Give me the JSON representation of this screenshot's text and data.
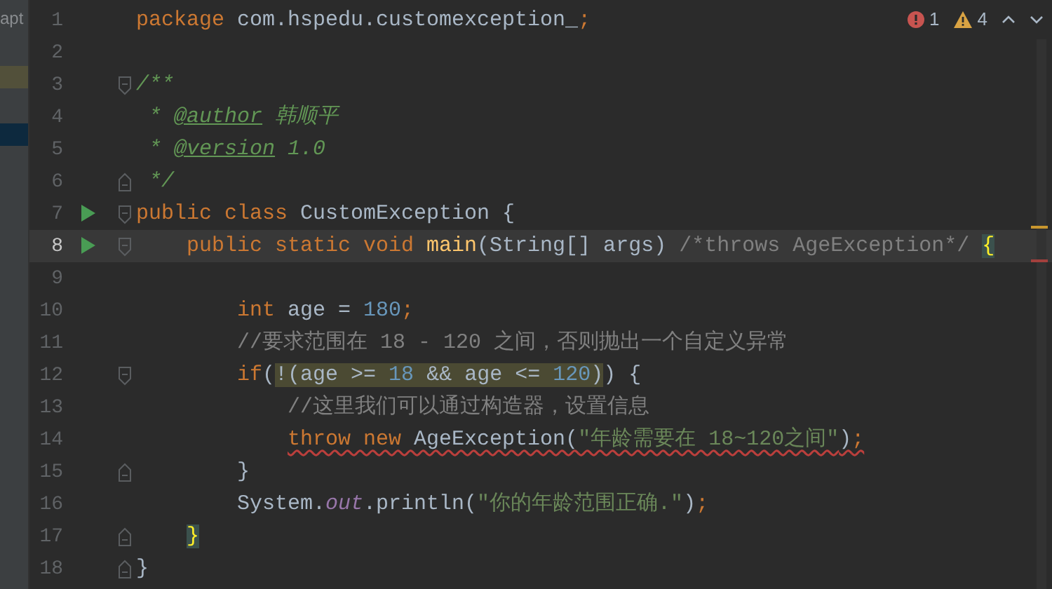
{
  "project_panel": {
    "label": "apt",
    "rows": [
      {
        "kind": "search-hit"
      },
      {
        "kind": "selected"
      }
    ]
  },
  "inspections": {
    "errors": "1",
    "warnings": "4"
  },
  "lines": [
    {
      "number": "1",
      "current": false,
      "run": false,
      "fold_open": false,
      "fold_close": false,
      "tokens": [
        {
          "kind": "keyword",
          "text": "package"
        },
        {
          "kind": "plain",
          "text": " com.hspedu.customexception_"
        },
        {
          "kind": "punct",
          "text": ";"
        }
      ]
    },
    {
      "number": "2",
      "current": false,
      "run": false,
      "fold_open": false,
      "fold_close": false
    },
    {
      "number": "3",
      "current": false,
      "run": false,
      "fold_open": true,
      "fold_close": false,
      "tokens": [
        {
          "kind": "doc",
          "text": "/**"
        }
      ]
    },
    {
      "number": "4",
      "current": false,
      "run": false,
      "fold_open": false,
      "fold_close": false,
      "tokens": [
        {
          "kind": "doc",
          "text": " * "
        },
        {
          "kind": "doctag",
          "text": "@author"
        },
        {
          "kind": "doc",
          "text": " 韩顺平"
        }
      ]
    },
    {
      "number": "5",
      "current": false,
      "run": false,
      "fold_open": false,
      "fold_close": false,
      "tokens": [
        {
          "kind": "doc",
          "text": " * "
        },
        {
          "kind": "doctag",
          "text": "@version"
        },
        {
          "kind": "doc",
          "text": " 1.0"
        }
      ]
    },
    {
      "number": "6",
      "current": false,
      "run": false,
      "fold_open": false,
      "fold_close": true,
      "tokens": [
        {
          "kind": "doc",
          "text": " */"
        }
      ]
    },
    {
      "number": "7",
      "current": false,
      "run": true,
      "fold_open": true,
      "fold_close": false,
      "tokens": [
        {
          "kind": "keyword",
          "text": "public class "
        },
        {
          "kind": "plain",
          "text": "CustomException {"
        }
      ]
    },
    {
      "number": "8",
      "current": true,
      "run": true,
      "fold_open": true,
      "fold_close": false,
      "tokens": [
        {
          "kind": "keyword",
          "text": "    public static void "
        },
        {
          "kind": "method",
          "text": "main"
        },
        {
          "kind": "plain",
          "text": "(String[] args) "
        },
        {
          "kind": "comment",
          "text": "/*throws AgeException*/"
        },
        {
          "kind": "brace",
          "text": " {"
        }
      ]
    },
    {
      "number": "9",
      "current": false,
      "run": false,
      "fold_open": false,
      "fold_close": false
    },
    {
      "number": "10",
      "current": false,
      "run": false,
      "fold_open": false,
      "fold_close": false,
      "tokens": [
        {
          "kind": "keyword",
          "text": "        int "
        },
        {
          "kind": "plain",
          "text": "age = "
        },
        {
          "kind": "number",
          "text": "180"
        },
        {
          "kind": "punct",
          "text": ";"
        }
      ]
    },
    {
      "number": "11",
      "current": false,
      "run": false,
      "fold_open": false,
      "fold_close": false,
      "tokens": [
        {
          "kind": "comment",
          "text": "        //要求范围在 18 - 120 之间，否则抛出一个自定义异常"
        }
      ]
    },
    {
      "number": "12",
      "current": false,
      "run": false,
      "fold_open": true,
      "fold_close": false,
      "tokens": [
        {
          "kind": "keyword",
          "text": "        if"
        },
        {
          "kind": "plain",
          "text": "("
        },
        {
          "kind": "highlight",
          "children": [
            {
              "kind": "plain",
              "text": "!(age >= "
            },
            {
              "kind": "number",
              "text": "18"
            },
            {
              "kind": "plain",
              "text": " && age <= "
            },
            {
              "kind": "number",
              "text": "120"
            },
            {
              "kind": "plain",
              "text": ")"
            }
          ]
        },
        {
          "kind": "plain",
          "text": ") {"
        }
      ]
    },
    {
      "number": "13",
      "current": false,
      "run": false,
      "fold_open": false,
      "fold_close": false,
      "tokens": [
        {
          "kind": "comment",
          "text": "            //这里我们可以通过构造器，设置信息"
        }
      ]
    },
    {
      "number": "14",
      "current": false,
      "run": false,
      "fold_open": false,
      "fold_close": false,
      "tokens": [
        {
          "kind": "error",
          "children": [
            {
              "kind": "keyword",
              "text": "            throw new "
            },
            {
              "kind": "plain",
              "text": "AgeException("
            },
            {
              "kind": "string",
              "text": "\"年龄需要在 18~120之间\""
            },
            {
              "kind": "plain",
              "text": ")"
            },
            {
              "kind": "punct",
              "text": ";"
            }
          ]
        }
      ]
    },
    {
      "number": "15",
      "current": false,
      "run": false,
      "fold_open": false,
      "fold_close": true,
      "tokens": [
        {
          "kind": "plain",
          "text": "        }"
        }
      ]
    },
    {
      "number": "16",
      "current": false,
      "run": false,
      "fold_open": false,
      "fold_close": false,
      "tokens": [
        {
          "kind": "plain",
          "text": "        System."
        },
        {
          "kind": "field",
          "text": "out"
        },
        {
          "kind": "plain",
          "text": ".println("
        },
        {
          "kind": "string",
          "text": "\"你的年龄范围正确.\""
        },
        {
          "kind": "plain",
          "text": ")"
        },
        {
          "kind": "punct",
          "text": ";"
        }
      ]
    },
    {
      "number": "17",
      "current": false,
      "run": false,
      "fold_open": false,
      "fold_close": true,
      "tokens": [
        {
          "kind": "brace",
          "text": "    }"
        }
      ]
    },
    {
      "number": "18",
      "current": false,
      "run": false,
      "fold_open": false,
      "fold_close": true,
      "tokens": [
        {
          "kind": "plain",
          "text": "}"
        }
      ]
    }
  ]
}
